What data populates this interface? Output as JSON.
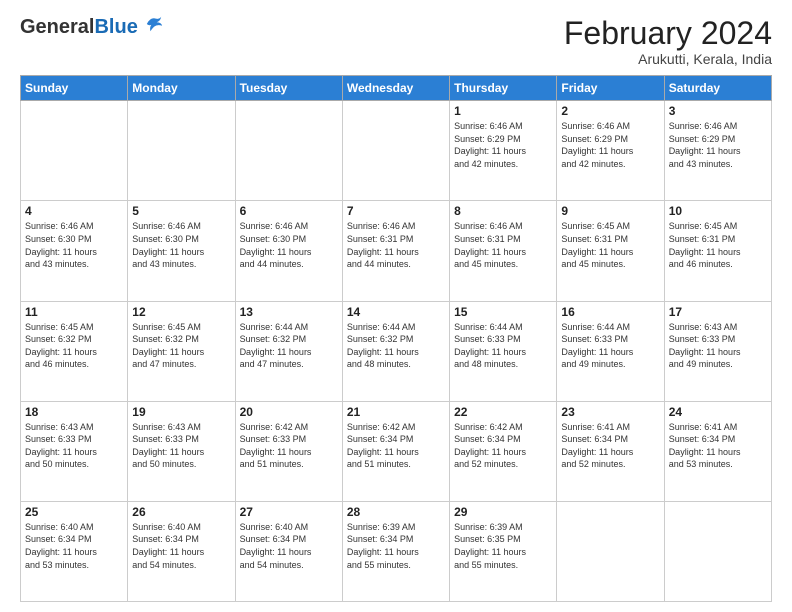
{
  "logo": {
    "general": "General",
    "blue": "Blue"
  },
  "header": {
    "month_year": "February 2024",
    "location": "Arukutti, Kerala, India"
  },
  "days_of_week": [
    "Sunday",
    "Monday",
    "Tuesday",
    "Wednesday",
    "Thursday",
    "Friday",
    "Saturday"
  ],
  "weeks": [
    [
      {
        "day": "",
        "info": ""
      },
      {
        "day": "",
        "info": ""
      },
      {
        "day": "",
        "info": ""
      },
      {
        "day": "",
        "info": ""
      },
      {
        "day": "1",
        "info": "Sunrise: 6:46 AM\nSunset: 6:29 PM\nDaylight: 11 hours\nand 42 minutes."
      },
      {
        "day": "2",
        "info": "Sunrise: 6:46 AM\nSunset: 6:29 PM\nDaylight: 11 hours\nand 42 minutes."
      },
      {
        "day": "3",
        "info": "Sunrise: 6:46 AM\nSunset: 6:29 PM\nDaylight: 11 hours\nand 43 minutes."
      }
    ],
    [
      {
        "day": "4",
        "info": "Sunrise: 6:46 AM\nSunset: 6:30 PM\nDaylight: 11 hours\nand 43 minutes."
      },
      {
        "day": "5",
        "info": "Sunrise: 6:46 AM\nSunset: 6:30 PM\nDaylight: 11 hours\nand 43 minutes."
      },
      {
        "day": "6",
        "info": "Sunrise: 6:46 AM\nSunset: 6:30 PM\nDaylight: 11 hours\nand 44 minutes."
      },
      {
        "day": "7",
        "info": "Sunrise: 6:46 AM\nSunset: 6:31 PM\nDaylight: 11 hours\nand 44 minutes."
      },
      {
        "day": "8",
        "info": "Sunrise: 6:46 AM\nSunset: 6:31 PM\nDaylight: 11 hours\nand 45 minutes."
      },
      {
        "day": "9",
        "info": "Sunrise: 6:45 AM\nSunset: 6:31 PM\nDaylight: 11 hours\nand 45 minutes."
      },
      {
        "day": "10",
        "info": "Sunrise: 6:45 AM\nSunset: 6:31 PM\nDaylight: 11 hours\nand 46 minutes."
      }
    ],
    [
      {
        "day": "11",
        "info": "Sunrise: 6:45 AM\nSunset: 6:32 PM\nDaylight: 11 hours\nand 46 minutes."
      },
      {
        "day": "12",
        "info": "Sunrise: 6:45 AM\nSunset: 6:32 PM\nDaylight: 11 hours\nand 47 minutes."
      },
      {
        "day": "13",
        "info": "Sunrise: 6:44 AM\nSunset: 6:32 PM\nDaylight: 11 hours\nand 47 minutes."
      },
      {
        "day": "14",
        "info": "Sunrise: 6:44 AM\nSunset: 6:32 PM\nDaylight: 11 hours\nand 48 minutes."
      },
      {
        "day": "15",
        "info": "Sunrise: 6:44 AM\nSunset: 6:33 PM\nDaylight: 11 hours\nand 48 minutes."
      },
      {
        "day": "16",
        "info": "Sunrise: 6:44 AM\nSunset: 6:33 PM\nDaylight: 11 hours\nand 49 minutes."
      },
      {
        "day": "17",
        "info": "Sunrise: 6:43 AM\nSunset: 6:33 PM\nDaylight: 11 hours\nand 49 minutes."
      }
    ],
    [
      {
        "day": "18",
        "info": "Sunrise: 6:43 AM\nSunset: 6:33 PM\nDaylight: 11 hours\nand 50 minutes."
      },
      {
        "day": "19",
        "info": "Sunrise: 6:43 AM\nSunset: 6:33 PM\nDaylight: 11 hours\nand 50 minutes."
      },
      {
        "day": "20",
        "info": "Sunrise: 6:42 AM\nSunset: 6:33 PM\nDaylight: 11 hours\nand 51 minutes."
      },
      {
        "day": "21",
        "info": "Sunrise: 6:42 AM\nSunset: 6:34 PM\nDaylight: 11 hours\nand 51 minutes."
      },
      {
        "day": "22",
        "info": "Sunrise: 6:42 AM\nSunset: 6:34 PM\nDaylight: 11 hours\nand 52 minutes."
      },
      {
        "day": "23",
        "info": "Sunrise: 6:41 AM\nSunset: 6:34 PM\nDaylight: 11 hours\nand 52 minutes."
      },
      {
        "day": "24",
        "info": "Sunrise: 6:41 AM\nSunset: 6:34 PM\nDaylight: 11 hours\nand 53 minutes."
      }
    ],
    [
      {
        "day": "25",
        "info": "Sunrise: 6:40 AM\nSunset: 6:34 PM\nDaylight: 11 hours\nand 53 minutes."
      },
      {
        "day": "26",
        "info": "Sunrise: 6:40 AM\nSunset: 6:34 PM\nDaylight: 11 hours\nand 54 minutes."
      },
      {
        "day": "27",
        "info": "Sunrise: 6:40 AM\nSunset: 6:34 PM\nDaylight: 11 hours\nand 54 minutes."
      },
      {
        "day": "28",
        "info": "Sunrise: 6:39 AM\nSunset: 6:34 PM\nDaylight: 11 hours\nand 55 minutes."
      },
      {
        "day": "29",
        "info": "Sunrise: 6:39 AM\nSunset: 6:35 PM\nDaylight: 11 hours\nand 55 minutes."
      },
      {
        "day": "",
        "info": ""
      },
      {
        "day": "",
        "info": ""
      }
    ]
  ]
}
